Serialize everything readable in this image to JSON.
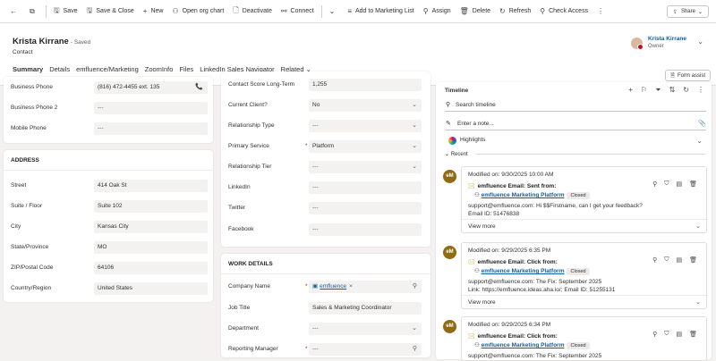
{
  "commands": [
    {
      "icon": "←",
      "label": ""
    },
    {
      "icon": "⧉",
      "label": ""
    },
    {
      "icon": "🖫",
      "label": "Save"
    },
    {
      "icon": "🖫",
      "label": "Save & Close"
    },
    {
      "icon": "+",
      "label": "New"
    },
    {
      "icon": "⚇",
      "label": "Open org chart"
    },
    {
      "icon": "🗋",
      "label": "Deactivate"
    },
    {
      "icon": "⚯",
      "label": "Connect"
    },
    {
      "icon": "⌄",
      "label": ""
    },
    {
      "icon": "≡",
      "label": "Add to Marketing List"
    },
    {
      "icon": "⚲",
      "label": "Assign"
    },
    {
      "icon": "🗑",
      "label": "Delete"
    },
    {
      "icon": "↻",
      "label": "Refresh"
    },
    {
      "icon": "⚲",
      "label": "Check Access"
    },
    {
      "icon": "⋮",
      "label": ""
    }
  ],
  "share_label": "Share",
  "record": {
    "name": "Krista Kirrane",
    "saved": "- Saved",
    "entity": "Contact"
  },
  "owner": {
    "name": "Krista Kirrane",
    "role": "Owner"
  },
  "tabs": [
    "Summary",
    "Details",
    "emfluence/Marketing",
    "ZoomInfo",
    "Files",
    "LinkedIn Sales Navigator",
    "Related"
  ],
  "form_assist": "Form assist",
  "contact_fields": [
    {
      "label": "Business Phone",
      "value": "(816) 472-4455 ext. 135"
    },
    {
      "label": "Business Phone 2",
      "value": "---"
    },
    {
      "label": "Mobile Phone",
      "value": "---"
    }
  ],
  "address": {
    "title": "ADDRESS",
    "fields": [
      {
        "label": "Street",
        "value": "414 Oak St"
      },
      {
        "label": "Suite / Floor",
        "value": "Suite 102"
      },
      {
        "label": "City",
        "value": "Kansas City"
      },
      {
        "label": "State/Province",
        "value": "MO"
      },
      {
        "label": "ZIP/Postal Code",
        "value": "64106"
      },
      {
        "label": "Country/Region",
        "value": "United States"
      }
    ]
  },
  "middle_fields": [
    {
      "label": "Contact Score Long-Term",
      "value": "1,255",
      "required": false
    },
    {
      "label": "Current Client?",
      "value": "No",
      "required": false
    },
    {
      "label": "Relationship Type",
      "value": "---",
      "required": false
    },
    {
      "label": "Primary Service",
      "value": "Platform",
      "required": true
    },
    {
      "label": "Relationship Tier",
      "value": "---",
      "required": false
    },
    {
      "label": "LinkedIn",
      "value": "---",
      "required": false
    },
    {
      "label": "Twitter",
      "value": "---",
      "required": false
    },
    {
      "label": "Facebook",
      "value": "---",
      "required": false
    }
  ],
  "work_details": {
    "title": "WORK DETAILS",
    "fields": [
      {
        "label": "Company Name",
        "value": "emfluence",
        "required": true
      },
      {
        "label": "Job Title",
        "value": "Sales & Marketing Coordinator",
        "required": false
      },
      {
        "label": "Department",
        "value": "---",
        "required": false
      },
      {
        "label": "Reporting Manager",
        "value": "---",
        "required": true
      }
    ]
  },
  "timeline": {
    "title": "Timeline",
    "search_placeholder": "Search timeline",
    "note_placeholder": "Enter a note...",
    "highlights": "Highlights",
    "recent": "Recent",
    "activities": [
      {
        "badge": "eM",
        "modified": "Modified on: 9/30/2025 10:00 AM",
        "subject": "emfluence Email: Sent from:",
        "from": "emfluence Marketing Platform",
        "status": "Closed",
        "body": [
          "support@emfluence.com: Hi $$Firstname, can I get your feedback?",
          "Email ID: 51476838"
        ],
        "more": "View more"
      },
      {
        "badge": "eM",
        "modified": "Modified on: 9/29/2025 6:35 PM",
        "subject": "emfluence Email: Click from:",
        "from": "emfluence Marketing Platform",
        "status": "Closed",
        "body": [
          "support@emfluence.com: The Fix: September 2025",
          "Link: https://emfluence.ideas.aha.io/; Email ID: 51255131"
        ],
        "more": "View more"
      },
      {
        "badge": "eM",
        "modified": "Modified on: 9/29/2025 6:34 PM",
        "subject": "emfluence Email: Click from:",
        "from": "emfluence Marketing Platform",
        "status": "Closed",
        "body": [
          "support@emfluence.com: The Fix: September 2025"
        ],
        "more": ""
      }
    ]
  }
}
